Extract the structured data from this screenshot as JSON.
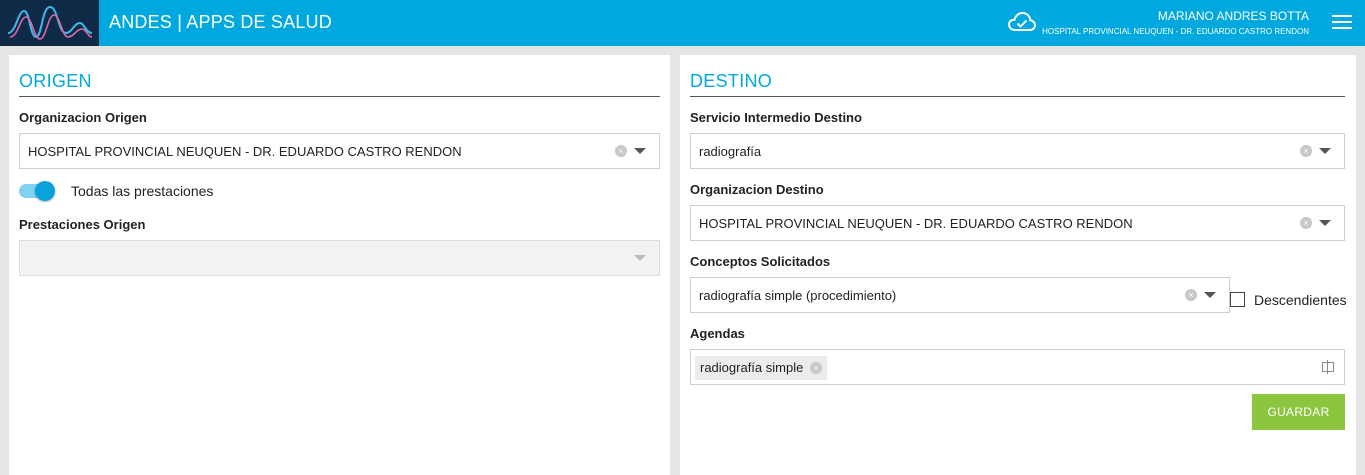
{
  "header": {
    "app_title": "ANDES | APPS DE SALUD",
    "user_name": "MARIANO ANDRES BOTTA",
    "user_org": "HOSPITAL PROVINCIAL NEUQUEN - DR. EDUARDO CASTRO RENDON",
    "icons": [
      "andes-logo",
      "cloud-icon",
      "menu-icon"
    ],
    "bg_color": "#00a8e0",
    "logo_bg_color": "#0f2a46"
  },
  "origen": {
    "title": "ORIGEN",
    "organizacion_label": "Organizacion Origen",
    "organizacion_value": "HOSPITAL PROVINCIAL NEUQUEN - DR. EDUARDO CASTRO RENDON",
    "toggle_label": "Todas las prestaciones",
    "toggle_on": true,
    "prestaciones_label": "Prestaciones Origen",
    "prestaciones_value": ""
  },
  "destino": {
    "title": "DESTINO",
    "servicio_label": "Servicio Intermedio Destino",
    "servicio_value": "radiografía",
    "organizacion_label": "Organizacion Destino",
    "organizacion_value": "HOSPITAL PROVINCIAL NEUQUEN - DR. EDUARDO CASTRO RENDON",
    "conceptos_label": "Conceptos Solicitados",
    "conceptos_value": "radiografía simple (procedimiento)",
    "descendientes_label": "Descendientes",
    "descendientes_checked": false,
    "agendas_label": "Agendas",
    "agendas_tags": [
      "radiografía simple"
    ],
    "save_label": "GUARDAR",
    "save_color": "#8cc63f"
  },
  "accent_color": "#00a8e0"
}
